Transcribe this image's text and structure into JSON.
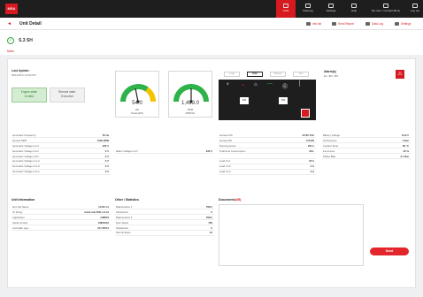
{
  "brand": {
    "logo": "MSA"
  },
  "nav": {
    "items": [
      {
        "label": "Units",
        "active": true
      },
      {
        "label": "Data log",
        "active": false
      },
      {
        "label": "Settings",
        "active": false
      },
      {
        "label": "Help",
        "active": false
      },
      {
        "label": "My User / Contact Menu",
        "active": false
      },
      {
        "label": "Log out",
        "active": false
      }
    ]
  },
  "subheader": {
    "back": "◄",
    "title": "Unit Detail",
    "tools": [
      {
        "label": "Info list",
        "icon": "list-icon"
      },
      {
        "label": "Send Report",
        "icon": "report-icon"
      },
      {
        "label": "Data Log",
        "icon": "datalog-icon"
      },
      {
        "label": "Settings",
        "icon": "gear-icon"
      }
    ]
  },
  "unit": {
    "name": "S.3 SH",
    "tab": "Main"
  },
  "last_update": {
    "label": "Last Update:",
    "value": "09/12/18 07:13:06 PM"
  },
  "engine_state": {
    "label": "Engine state:\nis Idled",
    "remote_label": "Remote state:\nExecution"
  },
  "gauges": [
    {
      "value": "54.0",
      "unit": "kW\nPower(kW)",
      "fraction": 0.45,
      "color": "#2db34a"
    },
    {
      "value": "1,499.0",
      "unit": "RPM\nRPM/Hz",
      "fraction": 0.5,
      "color": "#2db34a"
    }
  ],
  "modes": [
    {
      "label": "Load",
      "on": false
    },
    {
      "label": "Auto",
      "on": true
    },
    {
      "label": "Manual",
      "on": false
    },
    {
      "label": "Test",
      "on": false
    }
  ],
  "alarms": {
    "title": "Alarm(s)",
    "subtitle": "EJ • BC • BS"
  },
  "diagram": {
    "label1": "KW",
    "label2": "KW"
  },
  "left_table": [
    {
      "k": "Generator Frequency",
      "v": "50 Hz"
    },
    {
      "k": "Genset RPM",
      "v": "1500 RPM"
    },
    {
      "k": "Generator Voltage L1-N",
      "v": "230 V"
    },
    {
      "k": "Generator Voltage L2-N",
      "v": "0 V"
    },
    {
      "k": "Generator Voltage L3-N",
      "v": "0 V"
    },
    {
      "k": "Generator Voltage L1-L2",
      "v": "0 V"
    },
    {
      "k": "Generator Voltage L2-L3",
      "v": "0 V"
    },
    {
      "k": "Generator Voltage L3-L1",
      "v": "0 V"
    }
  ],
  "mid_table": [
    {
      "k": "Mains Voltage L1-N",
      "v": "230 V"
    }
  ],
  "right_table_a": [
    {
      "k": "Genset kVA",
      "v": "14797 kVA"
    },
    {
      "k": "Genset kW",
      "v": "2.8 kW"
    },
    {
      "k": "Running Hours",
      "v": "231 h"
    },
    {
      "k": "Total Fuel Consumption",
      "v": "38 L"
    },
    {
      "k": "",
      "v": ""
    },
    {
      "k": "Load 3 L1",
      "v": "20 A"
    },
    {
      "k": "Load 3 L2",
      "v": "0 A"
    },
    {
      "k": "Load 3 L3",
      "v": "0 A"
    }
  ],
  "right_table_b": [
    {
      "k": "Battery Voltage",
      "v": "21.8 V"
    },
    {
      "k": "Oil Pressure",
      "v": "5 Bar"
    },
    {
      "k": "Coolant Temp",
      "v": "66 °C"
    },
    {
      "k": "Fuel Level",
      "v": "30 %"
    },
    {
      "k": "Phase Balo",
      "v": "0.7 Bar"
    }
  ],
  "unit_info": {
    "title": "Unit Information",
    "rows": [
      {
        "k": "Gen Set Name",
        "v": "Unit5.4.4"
      },
      {
        "k": "IO String",
        "v": "InterLink-5781.1.3.13"
      },
      {
        "k": "Application",
        "v": "GMP22"
      },
      {
        "k": "Serial number",
        "v": "10861944"
      },
      {
        "k": "Controller type",
        "v": "IG7-DTA4"
      }
    ]
  },
  "other": {
    "title": "Other / Statistics",
    "rows": [
      {
        "k": "Maintenance 1",
        "v": "798 h"
      },
      {
        "k": "Shutdowns",
        "v": "0"
      },
      {
        "k": "Maintenance 2",
        "v": "798 h"
      },
      {
        "k": "Num Starts",
        "v": "760"
      },
      {
        "k": "Shutdowns",
        "v": "0"
      },
      {
        "k": "Num E-Stops",
        "v": "12"
      }
    ]
  },
  "documents": {
    "title": "Documents",
    "count": "(0/8)"
  },
  "send": {
    "label": "Send"
  }
}
